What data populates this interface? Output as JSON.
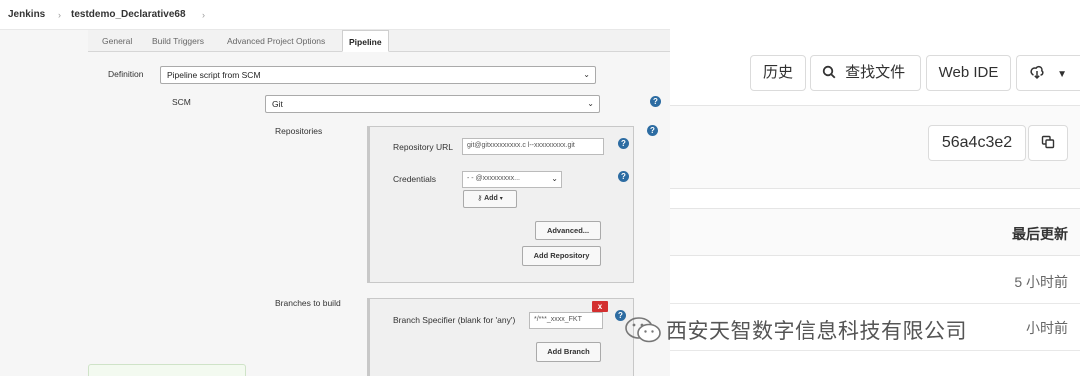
{
  "breadcrumb": {
    "root": "Jenkins",
    "job": "testdemo_Declarative68",
    "sep": "›"
  },
  "tabs": [
    "General",
    "Build Triggers",
    "Advanced Project Options",
    "Pipeline"
  ],
  "pipeline": {
    "definition_label": "Definition",
    "definition_value": "Pipeline script from SCM",
    "scm_label": "SCM",
    "scm_value": "Git",
    "repositories_label": "Repositories",
    "repo_url_label": "Repository URL",
    "repo_url_value": "git@gitxxxxxxxxx.c     l--xxxxxxxxx.git",
    "credentials_label": "Credentials",
    "credentials_value": "- - @xxxxxxxxx...",
    "add_label": "Add",
    "advanced_label": "Advanced...",
    "add_repository_label": "Add Repository",
    "branches_label": "Branches to build",
    "branch_specifier_label": "Branch Specifier (blank for 'any')",
    "branch_specifier_value": "*/***_xxxx_FKT",
    "delete_label": "x",
    "add_branch_label": "Add Branch",
    "help": "?"
  },
  "gitlab": {
    "history_label": "历史",
    "find_file_label": "查找文件",
    "web_ide_label": "Web IDE",
    "commit_sha": "56a4c3e2",
    "last_update_header": "最后更新",
    "row1_time": "5 小时前",
    "row2_time": "小时前"
  },
  "watermark": {
    "text": "西安天智数字信息科技有限公司"
  }
}
